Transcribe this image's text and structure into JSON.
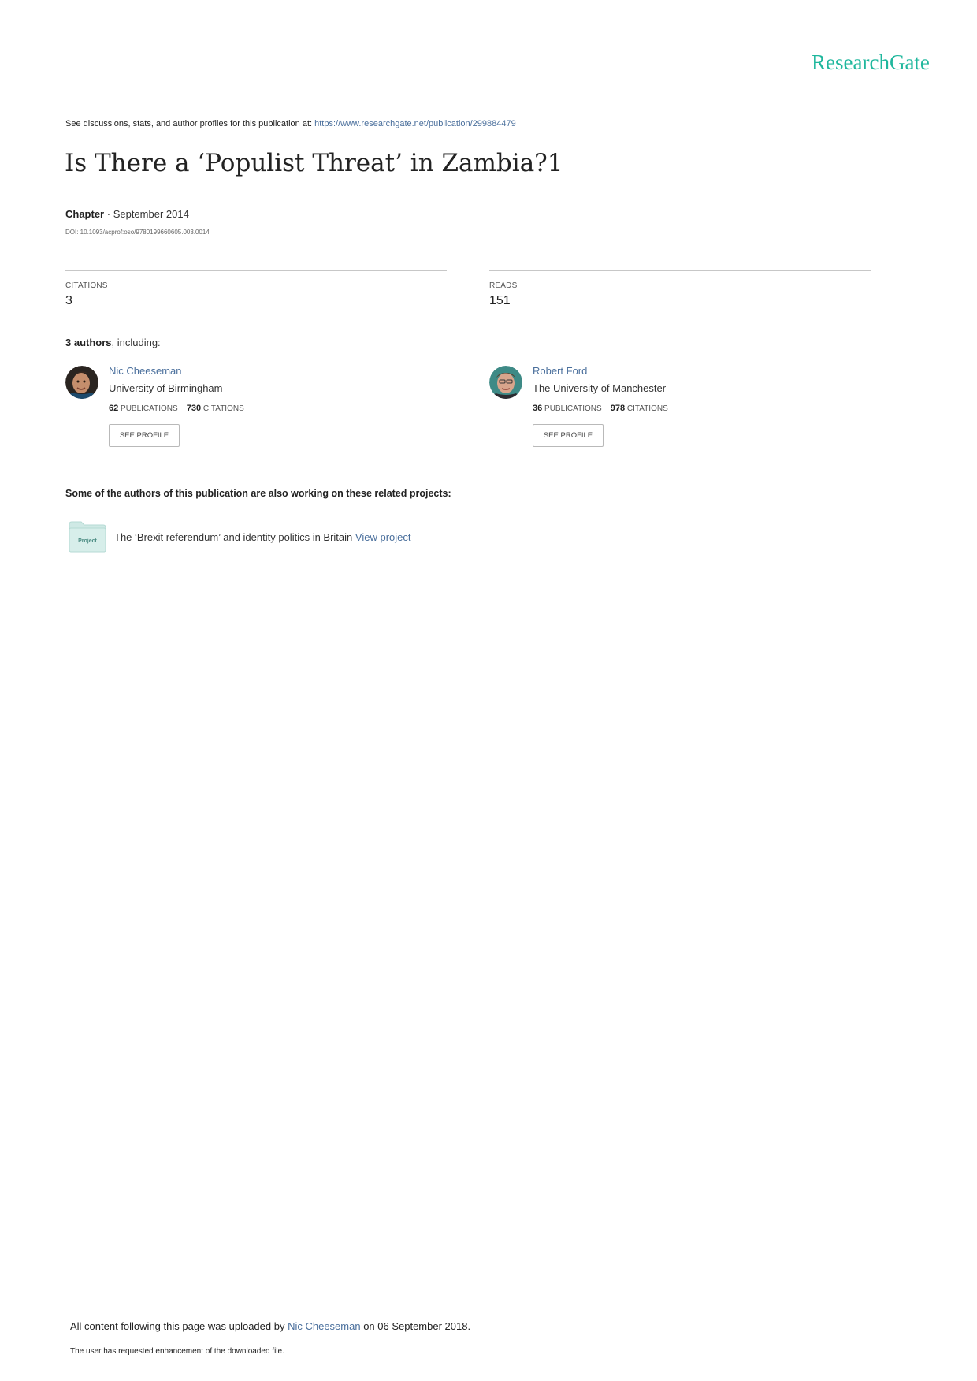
{
  "brand": {
    "name": "ResearchGate"
  },
  "header": {
    "see_text": "See discussions, stats, and author profiles for this publication at: ",
    "url": "https://www.researchgate.net/publication/299884479"
  },
  "publication": {
    "title": "Is There a ‘Populist Threat’ in Zambia?1",
    "type": "Chapter",
    "separator": " · ",
    "date": "September 2014",
    "doi": "DOI: 10.1093/acprof:oso/9780199660605.003.0014"
  },
  "stats": {
    "citations_label": "CITATIONS",
    "citations_value": "3",
    "reads_label": "READS",
    "reads_value": "151"
  },
  "authors_summary": {
    "count_text": "3 authors",
    "suffix": ", including:"
  },
  "authors": [
    {
      "name": "Nic Cheeseman",
      "institution": "University of Birmingham",
      "publications": "62",
      "publications_label": "PUBLICATIONS",
      "citations": "730",
      "citations_label": "CITATIONS",
      "button": "SEE PROFILE"
    },
    {
      "name": "Robert Ford",
      "institution": "The University of Manchester",
      "publications": "36",
      "publications_label": "PUBLICATIONS",
      "citations": "978",
      "citations_label": "CITATIONS",
      "button": "SEE PROFILE"
    }
  ],
  "projects": {
    "heading": "Some of the authors of this publication are also working on these related projects:",
    "items": [
      {
        "icon_label": "Project",
        "title": "The ‘Brexit referendum’ and identity politics in Britain",
        "link": "View project"
      }
    ]
  },
  "footer": {
    "upload_prefix": "All content following this page was uploaded by ",
    "uploader": "Nic Cheeseman",
    "upload_suffix": " on 06 September 2018.",
    "note": "The user has requested enhancement of the downloaded file."
  },
  "colors": {
    "brand": "#1fb79d",
    "link": "#4a6f9c",
    "project_icon": "#cfe9e5"
  }
}
